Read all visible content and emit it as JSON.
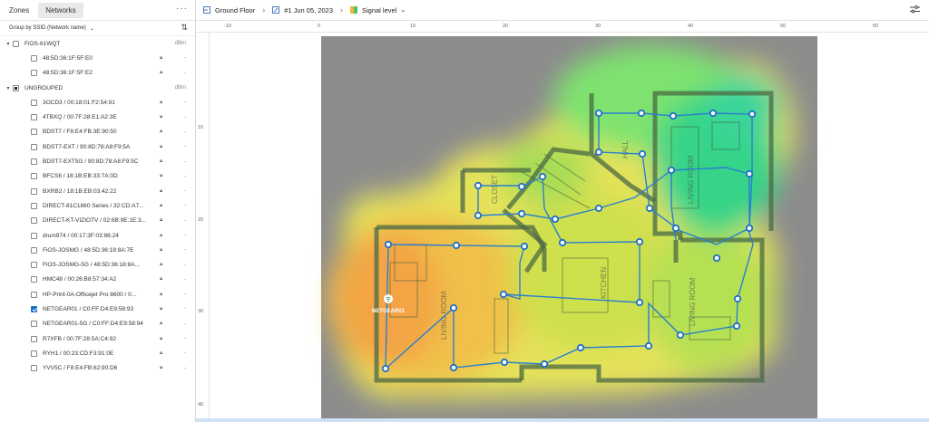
{
  "sidebar": {
    "tabs": [
      {
        "label": "Zones"
      },
      {
        "label": "Networks"
      }
    ],
    "group_by_label": "Group by SSID (Network name)",
    "groups": [
      {
        "name": "FiOS-61WQT",
        "unit": "dBm",
        "items": [
          {
            "label": "48:5D:36:1F:5F:E0",
            "value": "-",
            "checked": false
          },
          {
            "label": "48:5D:36:1F:5F:E2",
            "value": "-",
            "checked": false
          }
        ]
      },
      {
        "name": "UNGROUPED",
        "unit": "dBm",
        "items": [
          {
            "label": "3OCD3 / 00:18:01:F2:54:91",
            "value": "-",
            "checked": false
          },
          {
            "label": "4TBXQ / 00:7F:28:E1:A2:3E",
            "value": "-",
            "checked": false
          },
          {
            "label": "BDST7 / F8:E4:FB:3E:90:50",
            "value": "-",
            "checked": false
          },
          {
            "label": "BDST7-EXT / 90:8D:78:A8:F9:5A",
            "value": "-",
            "checked": false
          },
          {
            "label": "BDST7-EXT5G / 90:8D:78:A8:F9:5C",
            "value": "-",
            "checked": false
          },
          {
            "label": "BFCS6 / 18:1B:EB:33:7A:0D",
            "value": "-",
            "checked": false
          },
          {
            "label": "BXRB2 / 18:1B:EB:03:42:22",
            "value": "-",
            "checked": false
          },
          {
            "label": "DIRECT-81C1860 Series / 32:CD:A7...",
            "value": "-",
            "checked": false
          },
          {
            "label": "DIRECT-KT-VIZIOTV / 02:6B:9E:1E:3...",
            "value": "-",
            "checked": false
          },
          {
            "label": "drum974 / 00:17:3F:03:86:24",
            "value": "-",
            "checked": false
          },
          {
            "label": "FiOS-JOSMG / 48:5D:36:18:8A:7E",
            "value": "-",
            "checked": false
          },
          {
            "label": "FiOS-JOSMG-5G / 48:5D:36:18:8A...",
            "value": "-",
            "checked": false
          },
          {
            "label": "HMC48 / 00:26:B8:57:34:A2",
            "value": "-",
            "checked": false
          },
          {
            "label": "HP-Print-0A-Officejet Pro 8600 / 0...",
            "value": "-",
            "checked": false
          },
          {
            "label": "NETGEAR01 / C0:FF:D4:E9:58:93",
            "value": "-",
            "checked": true
          },
          {
            "label": "NETGEAR01-5G / C0:FF:D4:E9:58:94",
            "value": "-",
            "checked": false
          },
          {
            "label": "R7XFB / 00:7F:28:5A:C4:92",
            "value": "-",
            "checked": false
          },
          {
            "label": "RYH1 / 00:23:CD:F3:91:0E",
            "value": "-",
            "checked": false
          },
          {
            "label": "YVV5C / F8:E4:FB:62:90:D6",
            "value": "-",
            "checked": false
          }
        ]
      }
    ]
  },
  "toolbar": {
    "floor": "Ground Floor",
    "survey": "#1 Jun 05, 2023",
    "visualization": "Signal level"
  },
  "ruler": {
    "top": [
      "-10",
      "0",
      "10",
      "20",
      "30",
      "40",
      "50",
      "60"
    ],
    "left": [
      "10",
      "20",
      "30",
      "40"
    ]
  },
  "map": {
    "ap_label": "NETGEAR01",
    "room_labels": [
      "CLOSET",
      "LIVING ROOM",
      "KITCHEN",
      "HALL",
      "LIVING ROOM",
      "LIVING ROOM"
    ]
  },
  "colors": {
    "accent": "#1a73c9",
    "path": "#2a7fd0"
  }
}
